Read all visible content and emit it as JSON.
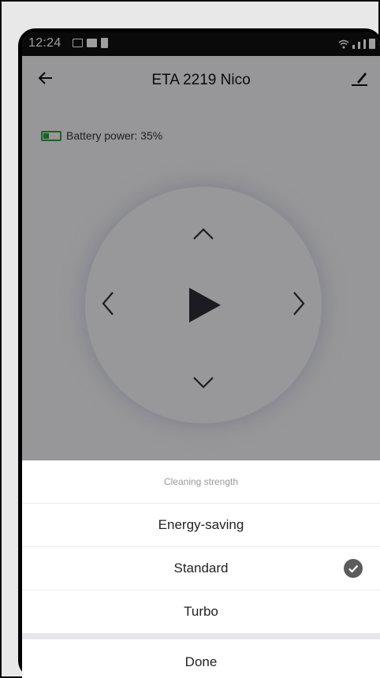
{
  "status_bar": {
    "time": "12:24"
  },
  "header": {
    "title": "ETA 2219 Nico"
  },
  "battery": {
    "label": "Battery power: 35%",
    "level_percent": 35,
    "color": "#2e9e3e"
  },
  "sheet": {
    "title": "Cleaning strength",
    "options": [
      {
        "label": "Energy-saving",
        "selected": false
      },
      {
        "label": "Standard",
        "selected": true
      },
      {
        "label": "Turbo",
        "selected": false
      }
    ],
    "done_label": "Done"
  },
  "icons": [
    "back-arrow-icon",
    "edit-icon",
    "battery-icon",
    "chevron-up-icon",
    "chevron-down-icon",
    "chevron-left-icon",
    "chevron-right-icon",
    "play-icon",
    "check-icon"
  ]
}
